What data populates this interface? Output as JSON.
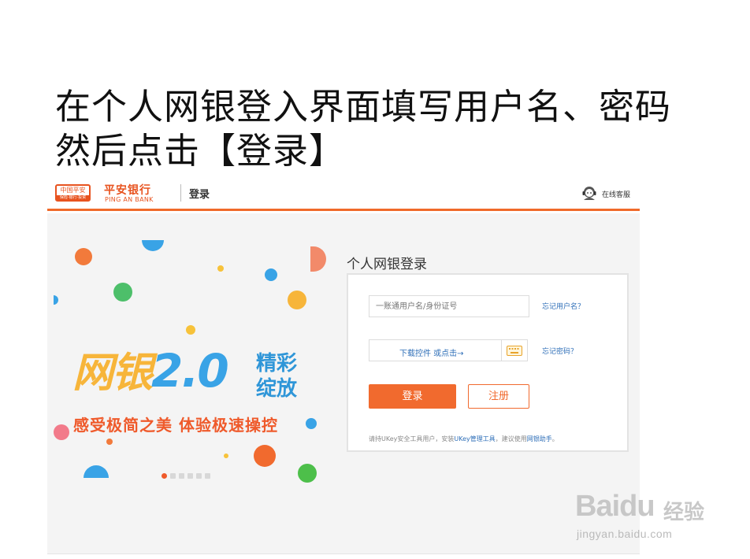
{
  "slide": {
    "title_line1": "在个人网银登入界面填写用户名、密码",
    "title_line2": "然后点击【登录】"
  },
  "header": {
    "badge_text": "中国平安",
    "badge_sub": "保险·银行·投资",
    "bank_name_cn": "平安银行",
    "bank_name_en": "PING AN BANK",
    "page_label": "登录",
    "support_label": "在线客服"
  },
  "banner": {
    "headline_left": "网银",
    "headline_version": "2.0",
    "headline_right_line1": "精彩",
    "headline_right_line2": "绽放",
    "slogan": "感受极简之美  体验极速操控",
    "pager_count": 6,
    "pager_active": 0
  },
  "login": {
    "title": "个人网银登录",
    "username_placeholder": "一账通用户名/身份证号",
    "forgot_username": "忘记用户名？",
    "password_prompt": "下载控件 或点击→",
    "forgot_password": "忘记密码？",
    "login_button": "登录",
    "register_button": "注册",
    "notice_prefix": "请持UKey安全工具用户，安装",
    "notice_link1": "UKey管理工具",
    "notice_mid": "，建议使用",
    "notice_link2": "网银助手",
    "notice_suffix": "。"
  },
  "watermark": {
    "brand": "Baidu",
    "product": "经验",
    "url": "jingyan.baidu.com"
  },
  "colors": {
    "accent": "#f16a2e",
    "link": "#2f6fb8",
    "banner_blue": "#39a3e6",
    "banner_yellow": "#f7b53a"
  }
}
